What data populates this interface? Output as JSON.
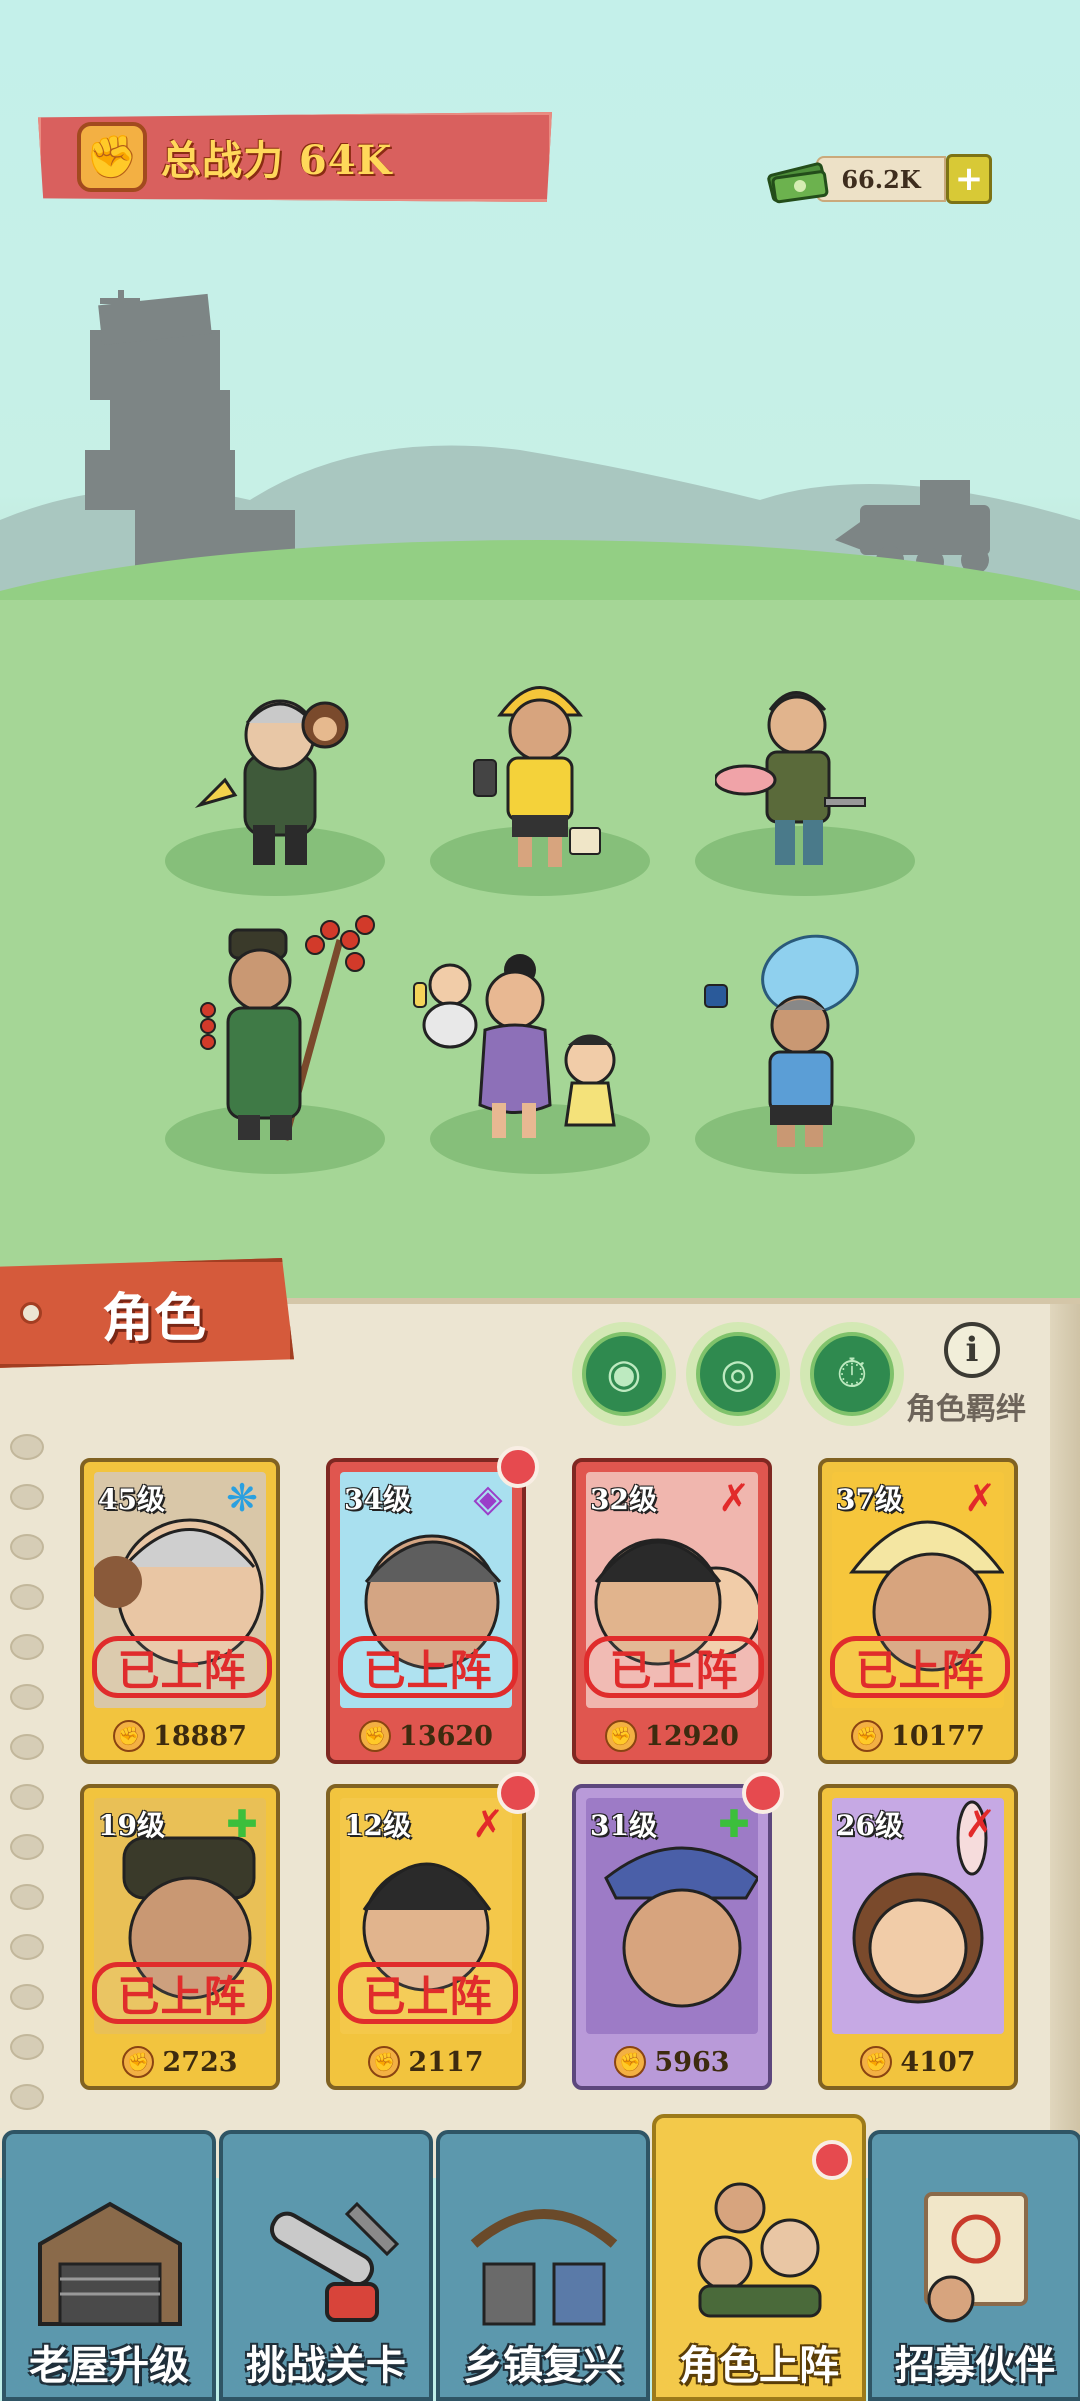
{
  "header": {
    "total_power_label": "总战力 64K",
    "currency_value": "66.2K",
    "currency_add_label": "+"
  },
  "panel": {
    "tab_label": "角色",
    "bond_label": "角色羁绊",
    "deployed_stamp": "已上阵"
  },
  "cards": [
    {
      "level": "45级",
      "power": "18887",
      "deployed": true,
      "type_icon": "paw-icon",
      "color": "gold"
    },
    {
      "level": "34级",
      "power": "13620",
      "deployed": true,
      "type_icon": "diamond-icon",
      "color": "red"
    },
    {
      "level": "32级",
      "power": "12920",
      "deployed": true,
      "type_icon": "sword-icon",
      "color": "red"
    },
    {
      "level": "37级",
      "power": "10177",
      "deployed": true,
      "type_icon": "sword-icon",
      "color": "gold"
    },
    {
      "level": "19级",
      "power": "2723",
      "deployed": true,
      "type_icon": "heal-cross-icon",
      "color": "gold"
    },
    {
      "level": "12级",
      "power": "2117",
      "deployed": true,
      "type_icon": "sword-icon",
      "color": "gold"
    },
    {
      "level": "31级",
      "power": "5963",
      "deployed": false,
      "type_icon": "heal-cross-icon",
      "color": "purple"
    },
    {
      "level": "26级",
      "power": "4107",
      "deployed": false,
      "type_icon": "sword-icon",
      "color": "gold"
    }
  ],
  "nav": {
    "items": [
      {
        "label": "老屋升级",
        "icon": "house-icon",
        "active": false
      },
      {
        "label": "挑战关卡",
        "icon": "chainsaw-icon",
        "active": false
      },
      {
        "label": "乡镇复兴",
        "icon": "market-icon",
        "active": false
      },
      {
        "label": "角色上阵",
        "icon": "characters-icon",
        "active": true
      },
      {
        "label": "招募伙伴",
        "icon": "recruit-icon",
        "active": false
      }
    ]
  },
  "colors": {
    "sky": "#c4f0ea",
    "grass": "#a5d696",
    "banner_red": "#d9605e",
    "card_gold": "#f2c43e",
    "card_red": "#e0564f",
    "card_purple": "#b99ad9",
    "nav_blue": "#5c98ad",
    "nav_active": "#f3c94a",
    "stamp_red": "#e02c2c"
  }
}
